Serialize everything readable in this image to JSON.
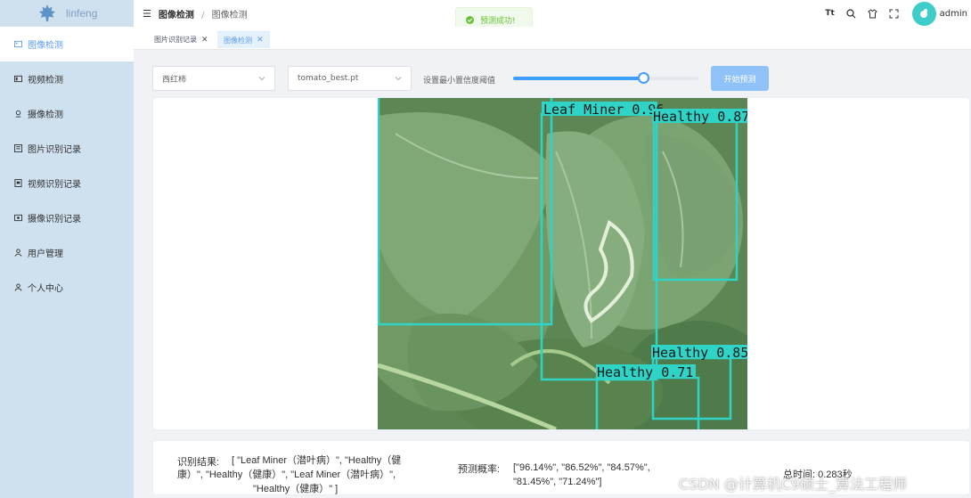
{
  "app": {
    "brand": "linfeng"
  },
  "sidebar": {
    "items": [
      {
        "label": "图像检测",
        "icon": "image-icon",
        "active": true
      },
      {
        "label": "视频检测",
        "icon": "video-icon",
        "active": false
      },
      {
        "label": "摄像检测",
        "icon": "camera-icon",
        "active": false
      },
      {
        "label": "图片识别记录",
        "icon": "record-icon",
        "active": false
      },
      {
        "label": "视频识别记录",
        "icon": "video-record-icon",
        "active": false
      },
      {
        "label": "摄像识别记录",
        "icon": "camera-record-icon",
        "active": false
      },
      {
        "label": "用户管理",
        "icon": "user-icon",
        "active": false
      },
      {
        "label": "个人中心",
        "icon": "person-icon",
        "active": false
      }
    ]
  },
  "header": {
    "breadcrumb": [
      "图像检测",
      "图像检测"
    ],
    "user": "admin"
  },
  "toast": {
    "text": "预测成功!"
  },
  "tags": [
    {
      "label": "图片识别记录",
      "active": false
    },
    {
      "label": "图像检测",
      "active": true
    }
  ],
  "controls": {
    "crop_select": "西红柿",
    "model_select": "tomato_best.pt",
    "confidence_label": "设置最小置信度阈值",
    "confidence_value": 0.7,
    "predict_button": "开始预测"
  },
  "detections": [
    {
      "label": "Leaf Miner 0.96"
    },
    {
      "label": "Healthy 0.87"
    },
    {
      "label": "Healthy 0.85"
    },
    {
      "label": "Healthy 0.71"
    }
  ],
  "result": {
    "label": "识别结果:",
    "line1": "[ \"Leaf Miner（潜叶病）\", \"Healthy（健",
    "line2": "康）\", \"Healthy（健康）\", \"Leaf Miner（潜叶病）\",",
    "line3": "\"Healthy（健康）\" ]",
    "prob_label": "预测概率:",
    "prob_line1": "[\"96.14%\", \"86.52%\", \"84.57%\",",
    "prob_line2": "\"81.45%\", \"71.24%\"]",
    "time_text": "总时间: 0.283秒"
  },
  "watermark": "CSDN @计算机C9硕士_算法工程师",
  "colors": {
    "accent": "#409eff",
    "box": "#2fd4c7",
    "sidebar": "#cfe0ee"
  }
}
